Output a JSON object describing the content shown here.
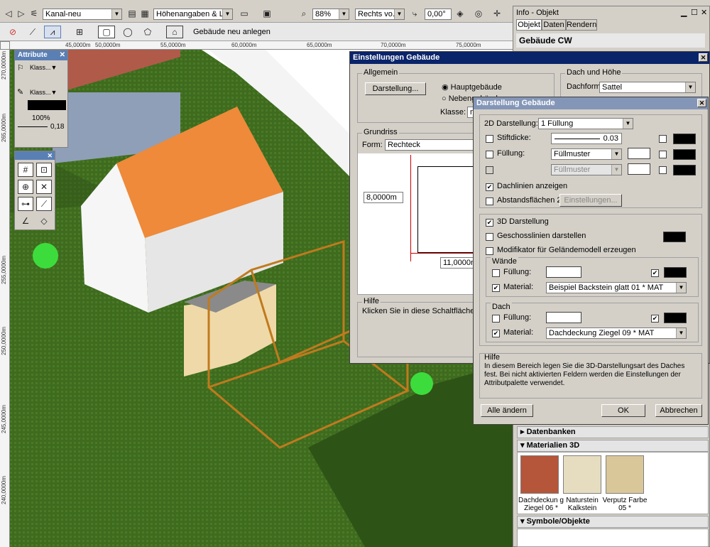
{
  "toolbar": {
    "class_combo": "Kanal-neu",
    "layer_combo": "Höhenangaben & Lin...",
    "zoom_combo": "88%",
    "view_combo": "Rechts vo...",
    "angle_field": "0,00°",
    "mode_label": "Gebäude neu anlegen"
  },
  "ruler": {
    "h_ticks": [
      "45,0000m",
      "50,0000m",
      "55,0000m",
      "60,0000m",
      "65,0000m",
      "70,0000m",
      "75,0000m"
    ],
    "v_ticks": [
      "270,0000m",
      "265,0000m",
      "255,0000m",
      "250,0000m",
      "245,0000m",
      "240,0000m"
    ]
  },
  "attribute_palette": {
    "title": "Attribute",
    "fill_class": "Klass...",
    "line_class": "Klass...",
    "opacity": "100%",
    "line_weight": "0,18"
  },
  "info_panel": {
    "title": "Info - Objekt",
    "tabs": [
      "Objekt",
      "Daten",
      "Rendern"
    ],
    "object_name": "Gebäude CW",
    "sections": {
      "databases": "Datenbanken",
      "materials": "Materialien 3D",
      "symbols": "Symbole/Objekte"
    },
    "materials": [
      {
        "label": "Dachdeckun g Ziegel 06 *",
        "color": "#b5553a"
      },
      {
        "label": "Naturstein Kalkstein",
        "color": "#e6dcc0"
      },
      {
        "label": "Verputz Farbe 05 *",
        "color": "#d9c79a"
      }
    ]
  },
  "dialog_building": {
    "title": "Einstellungen Gebäude",
    "general_group": "Allgemein",
    "display_button": "Darstellung...",
    "radio_main": "Hauptgebäude",
    "radio_secondary": "Nebengebäude",
    "class_label": "Klasse:",
    "class_value": "ne",
    "roof_group": "Dach und Höhe",
    "roof_form_label": "Dachform:",
    "roof_form_value": "Sattel",
    "floorplan_group": "Grundriss",
    "form_label": "Form:",
    "form_value": "Rechteck",
    "dim_width": "8,0000m",
    "dim_length": "11,0000m",
    "help_group": "Hilfe",
    "help_text": "Klicken Sie in diese Schaltfläche, um di"
  },
  "dialog_display": {
    "title": "Darstellung Gebäude",
    "display_2d_label": "2D Darstellung:",
    "display_2d_value": "1 Füllung",
    "pen_thickness_label": "Stiftdicke:",
    "pen_thickness_value": "0.03",
    "fill_label": "Füllung:",
    "fill_value": "Füllmuster",
    "fill2_value": "Füllmuster",
    "roof_lines_label": "Dachlinien anzeigen",
    "distance_areas_label": "Abstandsflächen 2D",
    "settings_button": "Einstellungen...",
    "display_3d_label": "3D Darstellung",
    "floor_lines_label": "Geschosslinien darstellen",
    "terrain_modifier_label": "Modifikator für Geländemodell erzeugen",
    "walls_group": "Wände",
    "walls_fill_label": "Füllung:",
    "walls_material_label": "Material:",
    "walls_material_value": "Beispiel Backstein glatt 01 * MAT",
    "roof_group": "Dach",
    "roof_fill_label": "Füllung:",
    "roof_material_label": "Material:",
    "roof_material_value": "Dachdeckung Ziegel 09 * MAT",
    "help_group": "Hilfe",
    "help_text": "In diesem Bereich legen Sie die 3D-Darstellungsart des Daches fest. Bei nicht aktivierten Feldern werden die Einstellungen der Attributpalette verwendet.",
    "change_all_button": "Alle ändern",
    "ok_button": "OK",
    "cancel_button": "Abbrechen"
  }
}
